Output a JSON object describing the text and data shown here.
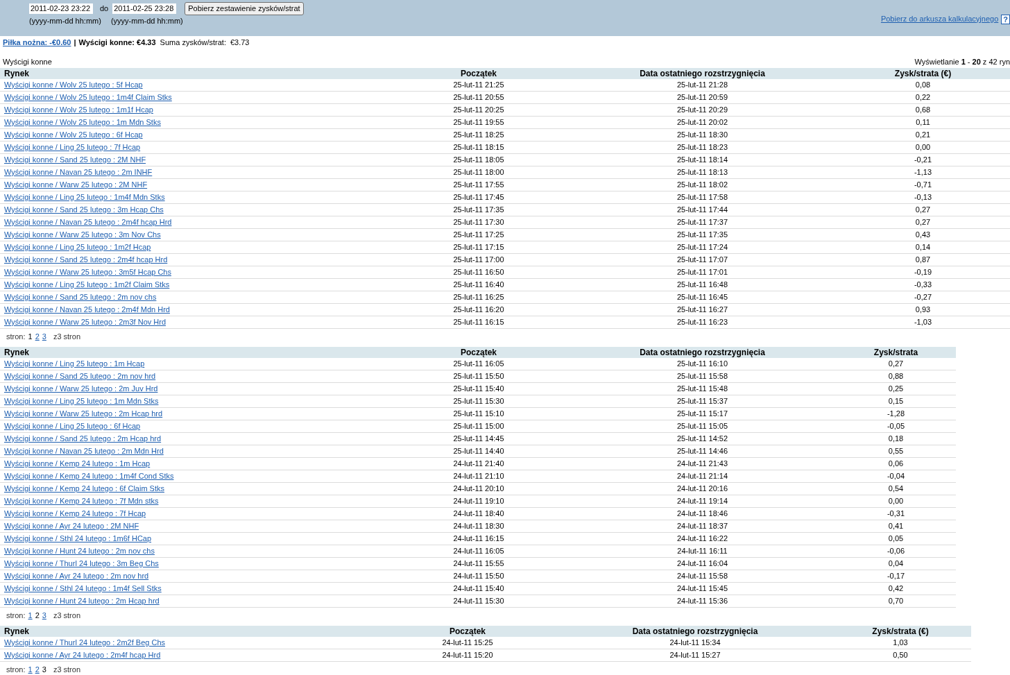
{
  "filter": {
    "from": "2011-02-23 23:22",
    "from_hint": "(yyyy-mm-dd hh:mm)",
    "to_label": "do",
    "to": "2011-02-25 23:28",
    "to_hint": "(yyyy-mm-dd hh:mm)",
    "button": "Pobierz zestawienie zysków/strat"
  },
  "export_link": "Pobierz do arkusza kalkulacyjnego",
  "help": "?",
  "summary": {
    "link": "Piłka nożna: -€0.60",
    "separator": "|",
    "bold": "Wyścigi konne: €4.33",
    "label": "Suma zysków/strat:",
    "value": "€3.73"
  },
  "section_title": "Wyścigi konne",
  "showing": "Wyświetlanie **1** - **20** z 42 ryn",
  "tables": [
    {
      "columns": [
        "Rynek",
        "Początek",
        "Data ostatniego rozstrzygnięcia",
        "Zysk/strata (€)"
      ],
      "rows": [
        [
          "Wyścigi konne / Wolv 25 lutego : 5f Hcap",
          "25-lut-11 21:25",
          "25-lut-11 21:28",
          "0,08"
        ],
        [
          "Wyścigi konne / Wolv 25 lutego : 1m4f Claim Stks",
          "25-lut-11 20:55",
          "25-lut-11 20:59",
          "0,22"
        ],
        [
          "Wyścigi konne / Wolv 25 lutego : 1m1f Hcap",
          "25-lut-11 20:25",
          "25-lut-11 20:29",
          "0,68"
        ],
        [
          "Wyścigi konne / Wolv 25 lutego : 1m Mdn Stks",
          "25-lut-11 19:55",
          "25-lut-11 20:02",
          "0,11"
        ],
        [
          "Wyścigi konne / Wolv 25 lutego : 6f Hcap",
          "25-lut-11 18:25",
          "25-lut-11 18:30",
          "0,21"
        ],
        [
          "Wyścigi konne / Ling 25 lutego : 7f Hcap",
          "25-lut-11 18:15",
          "25-lut-11 18:23",
          "0,00"
        ],
        [
          "Wyścigi konne / Sand 25 lutego : 2M NHF",
          "25-lut-11 18:05",
          "25-lut-11 18:14",
          "-0,21"
        ],
        [
          "Wyścigi konne / Navan 25 lutego : 2m INHF",
          "25-lut-11 18:00",
          "25-lut-11 18:13",
          "-1,13"
        ],
        [
          "Wyścigi konne / Warw 25 lutego : 2M NHF",
          "25-lut-11 17:55",
          "25-lut-11 18:02",
          "-0,71"
        ],
        [
          "Wyścigi konne / Ling 25 lutego : 1m4f Mdn Stks",
          "25-lut-11 17:45",
          "25-lut-11 17:58",
          "-0,13"
        ],
        [
          "Wyścigi konne / Sand 25 lutego : 3m Hcap Chs",
          "25-lut-11 17:35",
          "25-lut-11 17:44",
          "0,27"
        ],
        [
          "Wyścigi konne / Navan 25 lutego : 2m4f hcap Hrd",
          "25-lut-11 17:30",
          "25-lut-11 17:37",
          "0,27"
        ],
        [
          "Wyścigi konne / Warw 25 lutego : 3m Nov Chs",
          "25-lut-11 17:25",
          "25-lut-11 17:35",
          "0,43"
        ],
        [
          "Wyścigi konne / Ling 25 lutego : 1m2f Hcap",
          "25-lut-11 17:15",
          "25-lut-11 17:24",
          "0,14"
        ],
        [
          "Wyścigi konne / Sand 25 lutego : 2m4f hcap Hrd",
          "25-lut-11 17:00",
          "25-lut-11 17:07",
          "0,87"
        ],
        [
          "Wyścigi konne / Warw 25 lutego : 3m5f Hcap Chs",
          "25-lut-11 16:50",
          "25-lut-11 17:01",
          "-0,19"
        ],
        [
          "Wyścigi konne / Ling 25 lutego : 1m2f Claim Stks",
          "25-lut-11 16:40",
          "25-lut-11 16:48",
          "-0,33"
        ],
        [
          "Wyścigi konne / Sand 25 lutego : 2m nov chs",
          "25-lut-11 16:25",
          "25-lut-11 16:45",
          "-0,27"
        ],
        [
          "Wyścigi konne / Navan 25 lutego : 2m4f Mdn Hrd",
          "25-lut-11 16:20",
          "25-lut-11 16:27",
          "0,93"
        ],
        [
          "Wyścigi konne / Warw 25 lutego : 2m3f Nov Hrd",
          "25-lut-11 16:15",
          "25-lut-11 16:23",
          "-1,03"
        ]
      ],
      "pager": {
        "label": "stron:",
        "pages": [
          {
            "label": "1",
            "selected": true
          },
          {
            "label": "2",
            "selected": false
          },
          {
            "label": "3",
            "selected": false
          }
        ],
        "total": "z3 stron"
      }
    },
    {
      "columns": [
        "Rynek",
        "Początek",
        "Data ostatniego rozstrzygnięcia",
        "Zysk/strata"
      ],
      "rows": [
        [
          "Wyścigi konne / Ling 25 lutego : 1m Hcap",
          "25-lut-11 16:05",
          "25-lut-11 16:10",
          "0,27"
        ],
        [
          "Wyścigi konne / Sand 25 lutego : 2m nov hrd",
          "25-lut-11 15:50",
          "25-lut-11 15:58",
          "0,88"
        ],
        [
          "Wyścigi konne / Warw 25 lutego : 2m Juv Hrd",
          "25-lut-11 15:40",
          "25-lut-11 15:48",
          "0,25"
        ],
        [
          "Wyścigi konne / Ling 25 lutego : 1m Mdn Stks",
          "25-lut-11 15:30",
          "25-lut-11 15:37",
          "0,15"
        ],
        [
          "Wyścigi konne / Warw 25 lutego : 2m Hcap hrd",
          "25-lut-11 15:10",
          "25-lut-11 15:17",
          "-1,28"
        ],
        [
          "Wyścigi konne / Ling 25 lutego : 6f Hcap",
          "25-lut-11 15:00",
          "25-lut-11 15:05",
          "-0,05"
        ],
        [
          "Wyścigi konne / Sand 25 lutego : 2m Hcap hrd",
          "25-lut-11 14:45",
          "25-lut-11 14:52",
          "0,18"
        ],
        [
          "Wyścigi konne / Navan 25 lutego : 2m Mdn Hrd",
          "25-lut-11 14:40",
          "25-lut-11 14:46",
          "0,55"
        ],
        [
          "Wyścigi konne / Kemp 24 lutego : 1m Hcap",
          "24-lut-11 21:40",
          "24-lut-11 21:43",
          "0,06"
        ],
        [
          "Wyścigi konne / Kemp 24 lutego : 1m4f Cond Stks",
          "24-lut-11 21:10",
          "24-lut-11 21:14",
          "-0,04"
        ],
        [
          "Wyścigi konne / Kemp 24 lutego : 6f Claim Stks",
          "24-lut-11 20:10",
          "24-lut-11 20:16",
          "0,54"
        ],
        [
          "Wyścigi konne / Kemp 24 lutego : 7f Mdn stks",
          "24-lut-11 19:10",
          "24-lut-11 19:14",
          "0,00"
        ],
        [
          "Wyścigi konne / Kemp 24 lutego : 7f Hcap",
          "24-lut-11 18:40",
          "24-lut-11 18:46",
          "-0,31"
        ],
        [
          "Wyścigi konne / Ayr 24 lutego : 2M NHF",
          "24-lut-11 18:30",
          "24-lut-11 18:37",
          "0,41"
        ],
        [
          "Wyścigi konne / Sthl 24 lutego : 1m6f HCap",
          "24-lut-11 16:15",
          "24-lut-11 16:22",
          "0,05"
        ],
        [
          "Wyścigi konne / Hunt 24 lutego : 2m nov chs",
          "24-lut-11 16:05",
          "24-lut-11 16:11",
          "-0,06"
        ],
        [
          "Wyścigi konne / Thurl 24 lutego : 3m Beg Chs",
          "24-lut-11 15:55",
          "24-lut-11 16:04",
          "0,04"
        ],
        [
          "Wyścigi konne / Ayr 24 lutego : 2m nov hrd",
          "24-lut-11 15:50",
          "24-lut-11 15:58",
          "-0,17"
        ],
        [
          "Wyścigi konne / Sthl 24 lutego : 1m4f Sell Stks",
          "24-lut-11 15:40",
          "24-lut-11 15:45",
          "0,42"
        ],
        [
          "Wyścigi konne / Hunt 24 lutego : 2m Hcap hrd",
          "24-lut-11 15:30",
          "24-lut-11 15:36",
          "0,70"
        ]
      ],
      "pager": {
        "label": "stron:",
        "pages": [
          {
            "label": "1",
            "selected": false
          },
          {
            "label": "2",
            "selected": true
          },
          {
            "label": "3",
            "selected": false
          }
        ],
        "total": "z3 stron"
      }
    },
    {
      "columns": [
        "Rynek",
        "Początek",
        "Data ostatniego rozstrzygnięcia",
        "Zysk/strata (€)"
      ],
      "rows": [
        [
          "Wyścigi konne / Thurl 24 lutego : 2m2f Beg Chs",
          "24-lut-11 15:25",
          "24-lut-11 15:34",
          "1,03"
        ],
        [
          "Wyścigi konne / Ayr 24 lutego : 2m4f hcap Hrd",
          "24-lut-11 15:20",
          "24-lut-11 15:27",
          "0,50"
        ]
      ],
      "pager": {
        "label": "stron:",
        "pages": [
          {
            "label": "1",
            "selected": false
          },
          {
            "label": "2",
            "selected": false
          },
          {
            "label": "3",
            "selected": true
          }
        ],
        "total": "z3 stron"
      }
    }
  ]
}
